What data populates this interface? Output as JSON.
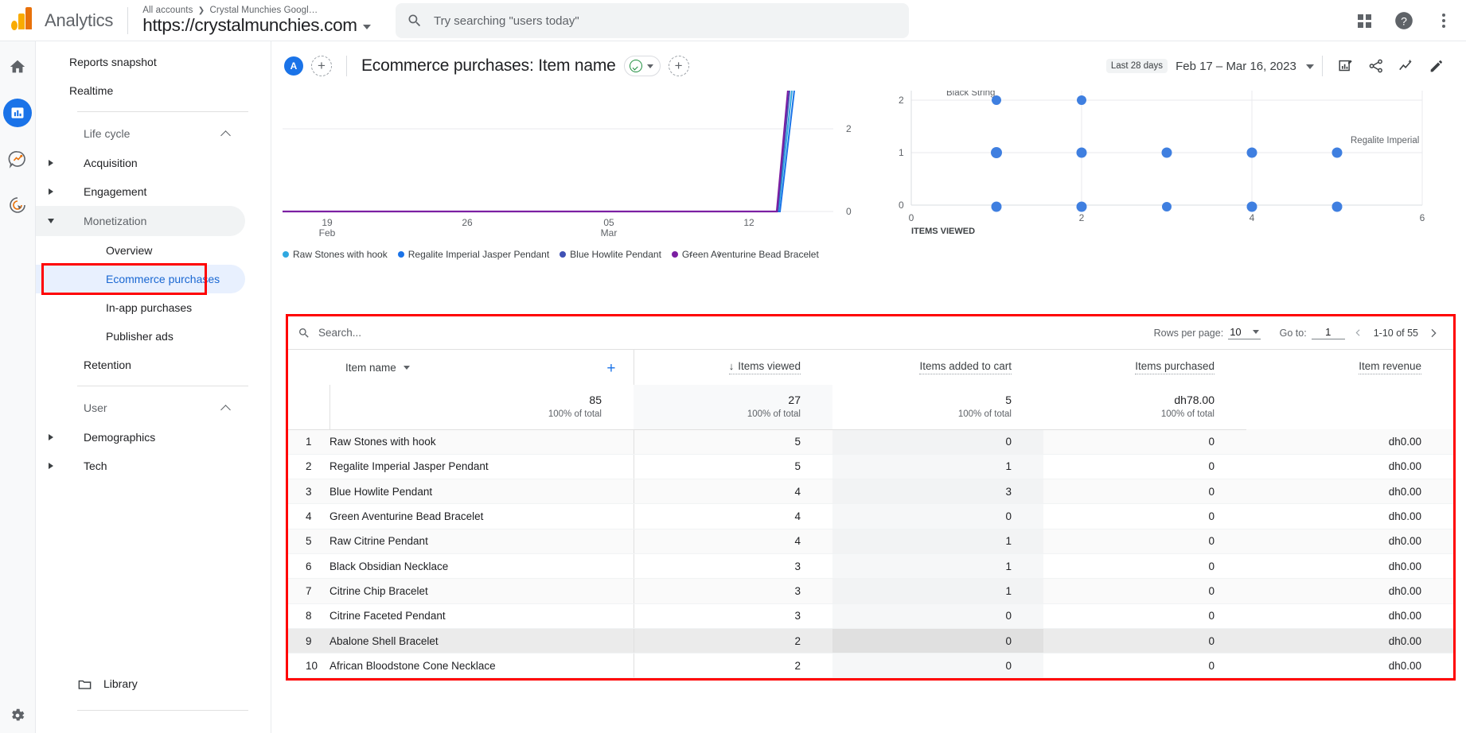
{
  "topbar": {
    "brand": "Analytics",
    "account_breadcrumb_all": "All accounts",
    "account_breadcrumb_sep": "❯",
    "account_breadcrumb_name": "Crystal Munchies Googl…",
    "property": "https://crystalmunchies.com",
    "search_placeholder": "Try searching \"users today\""
  },
  "rail": {
    "icons": [
      "home-icon",
      "reports-icon",
      "explore-icon",
      "advertising-icon",
      "admin-gear-icon"
    ]
  },
  "sidebar": {
    "reports_snapshot": "Reports snapshot",
    "realtime": "Realtime",
    "life_cycle": "Life cycle",
    "acquisition": "Acquisition",
    "engagement": "Engagement",
    "monetization": "Monetization",
    "overview": "Overview",
    "ecommerce_purchases": "Ecommerce purchases",
    "in_app_purchases": "In-app purchases",
    "publisher_ads": "Publisher ads",
    "retention": "Retention",
    "user": "User",
    "demographics": "Demographics",
    "tech": "Tech",
    "library": "Library"
  },
  "report": {
    "avatar_initial": "A",
    "title": "Ecommerce purchases: Item name",
    "date_badge": "Last 28 days",
    "date_range": "Feb 17 – Mar 16, 2023"
  },
  "chart_data": [
    {
      "type": "line",
      "title": "",
      "xlabel": "",
      "ylabel": "",
      "x_ticks": [
        "19\nFeb",
        "26",
        "05\nMar",
        "12"
      ],
      "y_ticks": [
        0,
        2
      ],
      "ylim": [
        0,
        3
      ],
      "legend_position": "bottom",
      "series": [
        {
          "name": "Raw Stones with hook",
          "color": "#30a8e0",
          "values": [
            0,
            0,
            0,
            0,
            0,
            0,
            0,
            0,
            0,
            0,
            0,
            0,
            0,
            0,
            0,
            0,
            0,
            0,
            0,
            0,
            0,
            0,
            0,
            0,
            0,
            2.6
          ]
        },
        {
          "name": "Regalite Imperial Jasper Pendant",
          "color": "#1a73e8",
          "values": [
            0,
            0,
            0,
            0,
            0,
            0,
            0,
            0,
            0,
            0,
            0,
            0,
            0,
            0,
            0,
            0,
            0,
            0,
            0,
            0,
            0,
            0,
            0,
            0,
            0,
            3.0
          ]
        },
        {
          "name": "Blue Howlite Pendant",
          "color": "#3f51b5",
          "values": [
            0,
            0,
            0,
            0,
            0,
            0,
            0,
            0,
            0,
            0,
            0,
            0,
            0,
            0,
            0,
            0,
            0,
            0,
            0,
            0,
            0,
            0,
            0,
            0,
            0,
            2.8
          ]
        },
        {
          "name": "Green Aventurine Bead Bracelet",
          "color": "#7b1fa2",
          "values": [
            0,
            0,
            0,
            0,
            0,
            0,
            0,
            0,
            0,
            0,
            0,
            0,
            0,
            0,
            0,
            0,
            0,
            0,
            0,
            0,
            0,
            0,
            0,
            0,
            0,
            2.7
          ]
        }
      ]
    },
    {
      "type": "scatter",
      "title": "",
      "xlabel": "ITEMS VIEWED",
      "ylabel": "",
      "x_ticks": [
        0,
        2,
        4,
        6
      ],
      "y_ticks": [
        0,
        1,
        2
      ],
      "xlim": [
        0,
        6
      ],
      "ylim": [
        0,
        2.2
      ],
      "point_color": "#3f7fe0",
      "annotations": [
        "Black String",
        "Regalite Imperial"
      ],
      "points": [
        {
          "x": 1,
          "y": 2
        },
        {
          "x": 2,
          "y": 2
        },
        {
          "x": 1,
          "y": 1
        },
        {
          "x": 2,
          "y": 1
        },
        {
          "x": 3,
          "y": 1
        },
        {
          "x": 4,
          "y": 1
        },
        {
          "x": 5,
          "y": 1
        },
        {
          "x": 1,
          "y": 0
        },
        {
          "x": 2,
          "y": 0
        },
        {
          "x": 3,
          "y": 0
        },
        {
          "x": 4,
          "y": 0
        },
        {
          "x": 5,
          "y": 0
        }
      ]
    }
  ],
  "table": {
    "search_placeholder": "Search...",
    "rows_per_page_label": "Rows per page:",
    "rows_per_page_value": "10",
    "goto_label": "Go to:",
    "goto_value": "1",
    "range": "1-10 of 55",
    "dimension_header": "Item name",
    "columns": [
      "Items viewed",
      "Items added to cart",
      "Items purchased",
      "Item revenue"
    ],
    "sorted_column": "Items viewed",
    "sort_direction": "desc",
    "totals": [
      "85",
      "27",
      "5",
      "dh78.00"
    ],
    "totals_subtitle": "100% of total",
    "rows": [
      {
        "idx": "1",
        "name": "Raw Stones with hook",
        "viewed": "5",
        "cart": "0",
        "purchased": "0",
        "revenue": "dh0.00"
      },
      {
        "idx": "2",
        "name": "Regalite Imperial Jasper Pendant",
        "viewed": "5",
        "cart": "1",
        "purchased": "0",
        "revenue": "dh0.00"
      },
      {
        "idx": "3",
        "name": "Blue Howlite Pendant",
        "viewed": "4",
        "cart": "3",
        "purchased": "0",
        "revenue": "dh0.00"
      },
      {
        "idx": "4",
        "name": "Green Aventurine Bead Bracelet",
        "viewed": "4",
        "cart": "0",
        "purchased": "0",
        "revenue": "dh0.00"
      },
      {
        "idx": "5",
        "name": "Raw Citrine Pendant",
        "viewed": "4",
        "cart": "1",
        "purchased": "0",
        "revenue": "dh0.00"
      },
      {
        "idx": "6",
        "name": "Black Obsidian Necklace",
        "viewed": "3",
        "cart": "1",
        "purchased": "0",
        "revenue": "dh0.00"
      },
      {
        "idx": "7",
        "name": "Citrine Chip Bracelet",
        "viewed": "3",
        "cart": "1",
        "purchased": "0",
        "revenue": "dh0.00"
      },
      {
        "idx": "8",
        "name": "Citrine Faceted Pendant",
        "viewed": "3",
        "cart": "0",
        "purchased": "0",
        "revenue": "dh0.00"
      },
      {
        "idx": "9",
        "name": "Abalone Shell Bracelet",
        "viewed": "2",
        "cart": "0",
        "purchased": "0",
        "revenue": "dh0.00"
      },
      {
        "idx": "10",
        "name": "African Bloodstone Cone Necklace",
        "viewed": "2",
        "cart": "0",
        "purchased": "0",
        "revenue": "dh0.00"
      }
    ]
  },
  "colors": {
    "accent": "#1a73e8",
    "highlight_box": "#ff0000",
    "active_nav_bg": "#e8f0fe"
  }
}
